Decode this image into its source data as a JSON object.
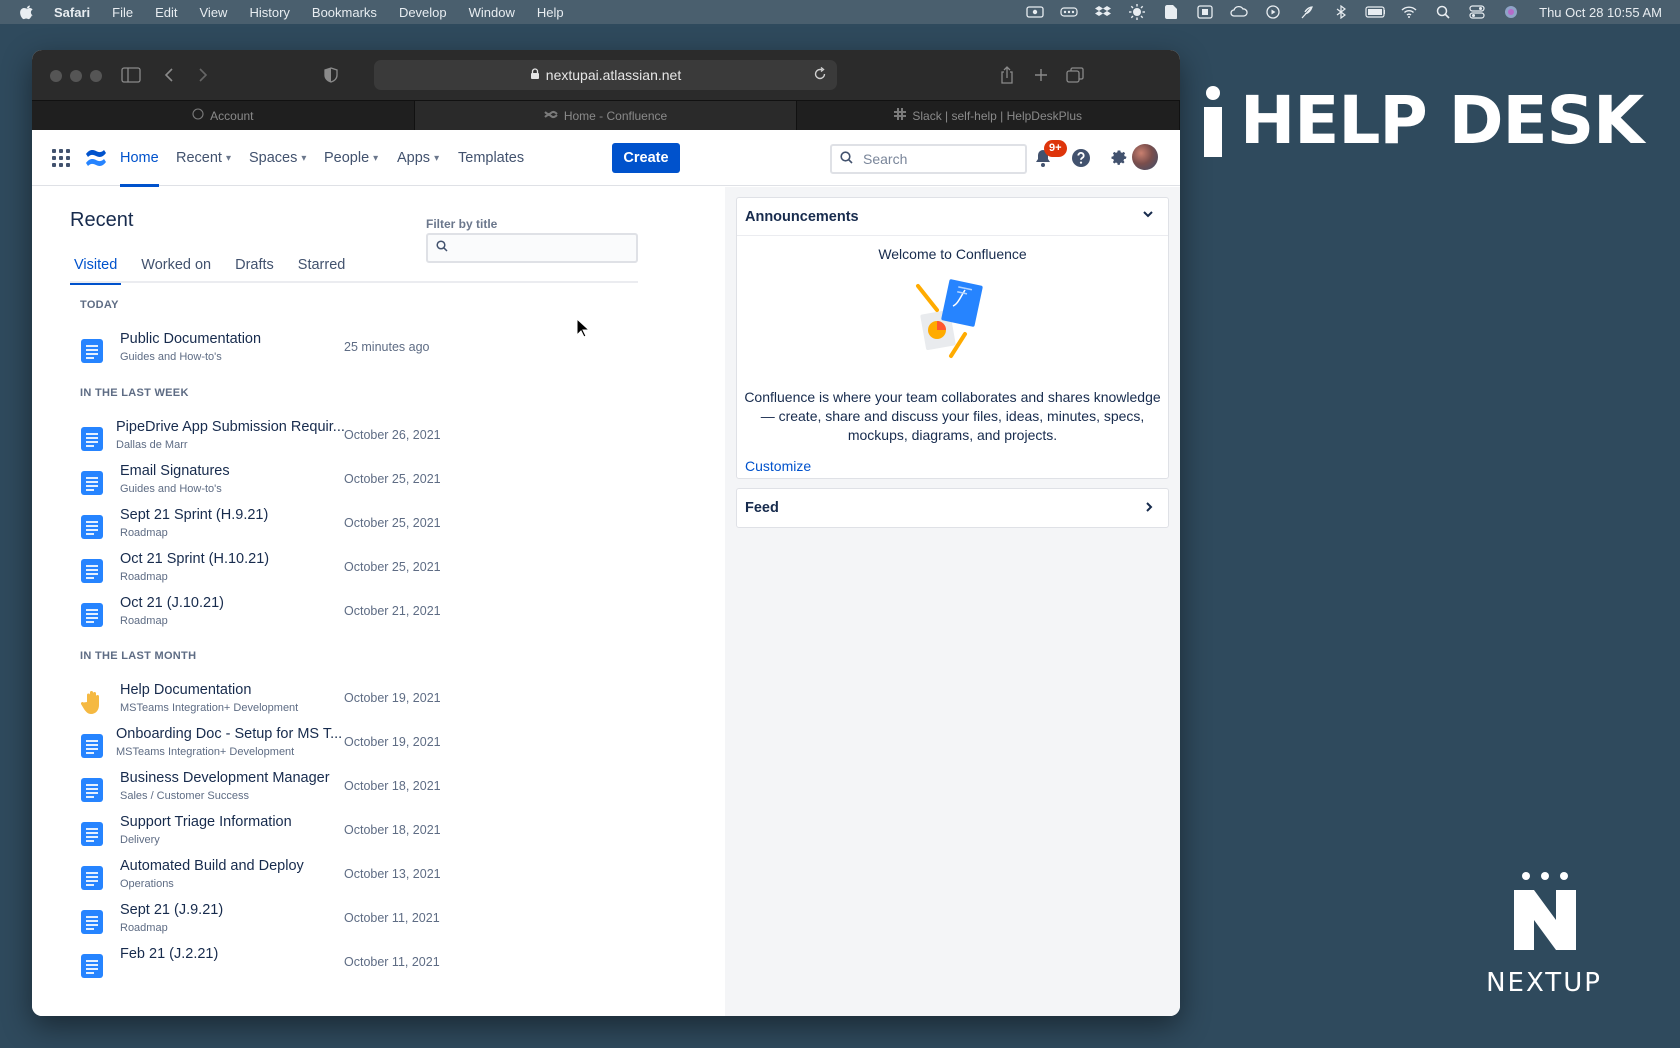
{
  "menubar": {
    "app": "Safari",
    "items": [
      "File",
      "Edit",
      "View",
      "History",
      "Bookmarks",
      "Develop",
      "Window",
      "Help"
    ],
    "clock": "Thu Oct 28  10:55 AM"
  },
  "browser": {
    "url": "nextupai.atlassian.net",
    "tabs": [
      {
        "label": "Account"
      },
      {
        "label": "Home - Confluence"
      },
      {
        "label": "Slack | self-help | HelpDeskPlus"
      }
    ]
  },
  "header": {
    "nav": [
      {
        "label": "Home"
      },
      {
        "label": "Recent"
      },
      {
        "label": "Spaces"
      },
      {
        "label": "People"
      },
      {
        "label": "Apps"
      },
      {
        "label": "Templates"
      }
    ],
    "create_label": "Create",
    "search_placeholder": "Search",
    "notification_badge": "9+"
  },
  "recent": {
    "title": "Recent",
    "filter_label": "Filter by title",
    "tabs": [
      "Visited",
      "Worked on",
      "Drafts",
      "Starred"
    ],
    "sections": [
      {
        "label": "TODAY",
        "items": [
          {
            "title": "Public Documentation",
            "space": "Guides and How-to's",
            "date": "25 minutes ago",
            "icon": "page-icon"
          }
        ]
      },
      {
        "label": "IN THE LAST WEEK",
        "items": [
          {
            "title": "PipeDrive App Submission Requir...",
            "space": "Dallas de Marr",
            "date": "October 26, 2021",
            "icon": "page-icon"
          },
          {
            "title": "Email Signatures",
            "space": "Guides and How-to's",
            "date": "October 25, 2021",
            "icon": "page-icon"
          },
          {
            "title": "Sept 21 Sprint (H.9.21)",
            "space": "Roadmap",
            "date": "October 25, 2021",
            "icon": "page-icon"
          },
          {
            "title": "Oct 21 Sprint (H.10.21)",
            "space": "Roadmap",
            "date": "October 25, 2021",
            "icon": "page-icon"
          },
          {
            "title": "Oct 21 (J.10.21)",
            "space": "Roadmap",
            "date": "October 21, 2021",
            "icon": "page-icon"
          }
        ]
      },
      {
        "label": "IN THE LAST MONTH",
        "items": [
          {
            "title": "Help Documentation",
            "space": "MSTeams Integration+ Development",
            "date": "October 19, 2021",
            "icon": "hand-icon"
          },
          {
            "title": "Onboarding Doc - Setup for MS T...",
            "space": "MSTeams Integration+ Development",
            "date": "October 19, 2021",
            "icon": "page-icon"
          },
          {
            "title": "Business Development Manager",
            "space": "Sales / Customer Success",
            "date": "October 18, 2021",
            "icon": "page-icon"
          },
          {
            "title": "Support Triage Information",
            "space": "Delivery",
            "date": "October 18, 2021",
            "icon": "page-icon"
          },
          {
            "title": "Automated Build and Deploy",
            "space": "Operations",
            "date": "October 13, 2021",
            "icon": "page-icon"
          },
          {
            "title": "Sept 21 (J.9.21)",
            "space": "Roadmap",
            "date": "October 11, 2021",
            "icon": "page-icon"
          },
          {
            "title": "Feb 21 (J.2.21)",
            "space": "",
            "date": "October 11, 2021",
            "icon": "page-icon"
          }
        ]
      }
    ]
  },
  "announcements": {
    "title": "Announcements",
    "welcome": "Welcome to Confluence",
    "body": "Confluence is where your team collaborates and shares knowledge — create, share and discuss your files, ideas, minutes, specs, mockups, diagrams, and projects.",
    "customize": "Customize"
  },
  "feed": {
    "title": "Feed"
  },
  "branding": {
    "helpdesk": "HELP DESK",
    "nextup": "NEXTUP"
  },
  "colors": {
    "accent": "#0052cc",
    "desktop": "#2f4a5d",
    "badge": "#de350b"
  }
}
